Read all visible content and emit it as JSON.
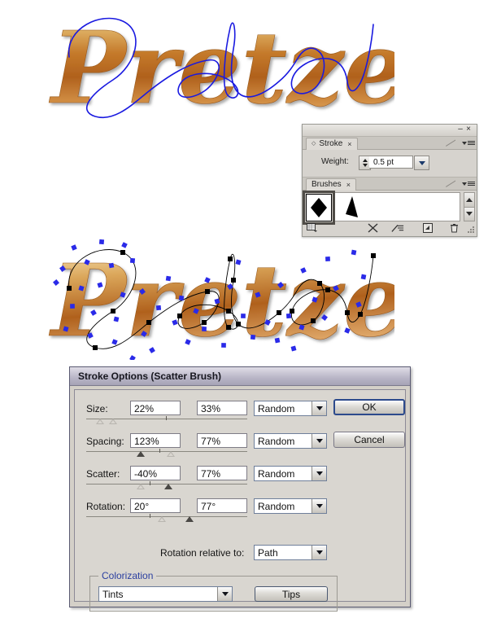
{
  "artwork": {
    "top": {
      "name": "pretzel-text-with-path",
      "text": "Pretzel",
      "path_color": "#1a1ae0",
      "fill_gradient": [
        "#f6e3a8",
        "#c8761f",
        "#a8541a",
        "#e9b26a"
      ]
    },
    "bottom": {
      "name": "pretzel-text-with-scatter-brush",
      "text": "Pretzel",
      "path_color": "#000000",
      "anchor_color": "#000000",
      "scatter_color": "#2a2ae8"
    }
  },
  "panel_group": {
    "minimize_glyph": "–",
    "close_glyph": "×",
    "stroke_panel": {
      "tab_label": "Stroke",
      "tab_close_glyph": "×",
      "weight_label": "Weight:",
      "weight_value": "0.5 pt"
    },
    "brushes_panel": {
      "tab_label": "Brushes",
      "tab_close_glyph": "×",
      "brushes": [
        {
          "name": "diamond-scatter-brush",
          "shape": "diamond",
          "selected": true
        },
        {
          "name": "triangle-scatter-brush",
          "shape": "triangle",
          "selected": false
        }
      ],
      "toolbar_icons": [
        "brush-libraries-icon",
        "remove-brush-stroke-icon",
        "options-of-selected-object-icon",
        "new-brush-icon",
        "delete-brush-icon"
      ]
    }
  },
  "dialog": {
    "title": "Stroke Options (Scatter Brush)",
    "rows": [
      {
        "label": "Size:",
        "value_min": "22%",
        "value_max": "33%",
        "mode": "Random",
        "track": {
          "tick_pct": 50,
          "markers": [
            {
              "pct": 9,
              "style": "hollow"
            },
            {
              "pct": 17,
              "style": "hollow"
            }
          ]
        }
      },
      {
        "label": "Spacing:",
        "value_min": "123%",
        "value_max": "77%",
        "mode": "Random",
        "track": {
          "tick_pct": 46,
          "markers": [
            {
              "pct": 34,
              "style": "solid"
            },
            {
              "pct": 52,
              "style": "hollow"
            }
          ]
        }
      },
      {
        "label": "Scatter:",
        "value_min": "-40%",
        "value_max": "77%",
        "mode": "Random",
        "track": {
          "tick_pct": 40,
          "markers": [
            {
              "pct": 34,
              "style": "hollow"
            },
            {
              "pct": 51,
              "style": "solid"
            }
          ]
        }
      },
      {
        "label": "Rotation:",
        "value_min": "20°",
        "value_max": "77°",
        "mode": "Random",
        "track": {
          "tick_pct": 40,
          "markers": [
            {
              "pct": 46,
              "style": "hollow"
            },
            {
              "pct": 63,
              "style": "solid"
            }
          ]
        }
      }
    ],
    "rotation_relative": {
      "label": "Rotation relative to:",
      "value": "Path"
    },
    "colorization": {
      "legend": "Colorization",
      "legend_color": "#2b3fa0",
      "method": "Tints",
      "tips_label": "Tips"
    },
    "ok_label": "OK",
    "cancel_label": "Cancel"
  }
}
